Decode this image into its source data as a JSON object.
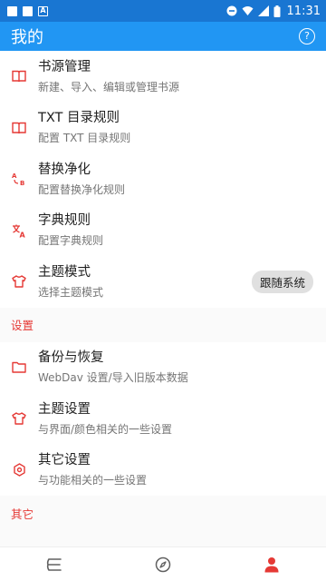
{
  "status_bar": {
    "time": "11:31",
    "a_badge": "A"
  },
  "app_bar": {
    "title": "我的",
    "help_glyph": "?"
  },
  "accent_color": "#e53935",
  "menu": [
    {
      "title": "书源管理",
      "subtitle": "新建、导入、编辑或管理书源",
      "icon": "book-icon"
    },
    {
      "title": "TXT 目录规则",
      "subtitle": "配置 TXT 目录规则",
      "icon": "book-icon"
    },
    {
      "title": "替换净化",
      "subtitle": "配置替换净化规则",
      "icon": "replace-icon"
    },
    {
      "title": "字典规则",
      "subtitle": "配置字典规则",
      "icon": "translate-icon"
    },
    {
      "title": "主题模式",
      "subtitle": "选择主题模式",
      "icon": "shirt-icon",
      "chip": "跟随系统"
    }
  ],
  "settings_section": {
    "label": "设置",
    "items": [
      {
        "title": "备份与恢复",
        "subtitle": "WebDav 设置/导入旧版本数据",
        "icon": "folder-icon"
      },
      {
        "title": "主题设置",
        "subtitle": "与界面/颜色相关的一些设置",
        "icon": "shirt-icon"
      },
      {
        "title": "其它设置",
        "subtitle": "与功能相关的一些设置",
        "icon": "settings-icon"
      }
    ]
  },
  "other_section": {
    "label": "其它"
  },
  "bottom_nav": [
    {
      "name": "bookshelf",
      "icon": "bookshelf-icon",
      "active": false
    },
    {
      "name": "discover",
      "icon": "compass-icon",
      "active": false
    },
    {
      "name": "my",
      "icon": "person-icon",
      "active": true
    }
  ]
}
